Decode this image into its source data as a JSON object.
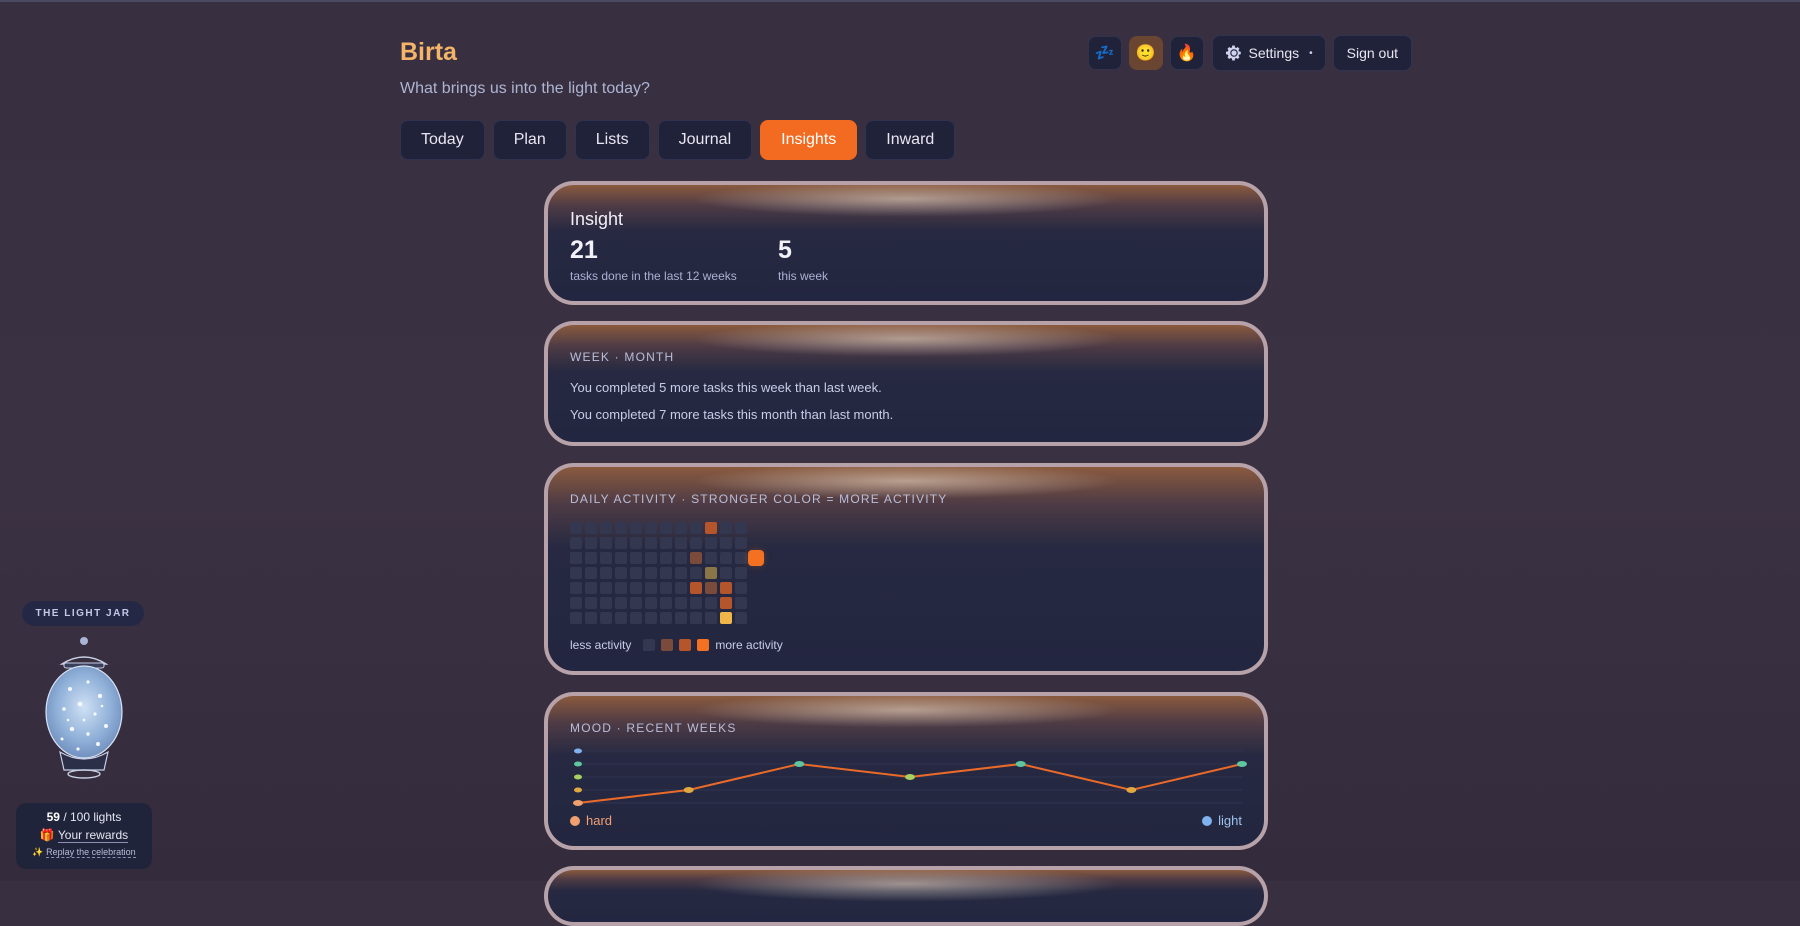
{
  "app": {
    "name": "Birta",
    "subtitle": "What brings us into the light today?"
  },
  "header": {
    "mood_buttons": [
      {
        "icon": "sleep-zz-icon",
        "glyph": "💤"
      },
      {
        "icon": "smile-face-icon",
        "glyph": "🙂"
      },
      {
        "icon": "fire-icon",
        "glyph": "🔥"
      }
    ],
    "settings_label": "Settings",
    "settings_dot": "•",
    "signout_label": "Sign out"
  },
  "tabs": [
    {
      "label": "Today",
      "active": false
    },
    {
      "label": "Plan",
      "active": false
    },
    {
      "label": "Lists",
      "active": false
    },
    {
      "label": "Journal",
      "active": false
    },
    {
      "label": "Insights",
      "active": true
    },
    {
      "label": "Inward",
      "active": false
    }
  ],
  "insight": {
    "title": "Insight",
    "stats": [
      {
        "value": "21",
        "label": "tasks done in the last 12 weeks"
      },
      {
        "value": "5",
        "label": "this week"
      }
    ]
  },
  "week_month": {
    "eyebrow": "WEEK · MONTH",
    "lines": [
      "You completed 5 more tasks this week than last week.",
      "You completed 7 more tasks this month than last month."
    ]
  },
  "activity": {
    "eyebrow": "DAILY ACTIVITY · STRONGER COLOR = MORE ACTIVITY",
    "less_label": "less activity",
    "more_label": "more activity",
    "colors": {
      "empty": "#33374f",
      "low": "#7a4a3a",
      "mid": "#b4552c",
      "high": "#f47122"
    }
  },
  "mood": {
    "eyebrow": "MOOD · RECENT WEEKS",
    "hard_label": "hard",
    "light_label": "light",
    "line_color": "#ea6a2a"
  },
  "chart_data": {
    "type": "line",
    "levels": 5,
    "series": [
      {
        "values": [
          1,
          2,
          4,
          3,
          4,
          2,
          4
        ]
      }
    ],
    "y_range": [
      1,
      5
    ],
    "y_axis_colors": [
      "#f0a070",
      "#e0a840",
      "#a8d060",
      "#5fc6a0",
      "#7fb2ee"
    ]
  },
  "jar": {
    "label": "THE LIGHT JAR",
    "count_current": "59",
    "count_rest": "/ 100 lights",
    "rewards_icon": "🎁",
    "rewards_label": "Your rewards",
    "replay_icon": "✨",
    "replay_label": "Replay the celebration"
  }
}
